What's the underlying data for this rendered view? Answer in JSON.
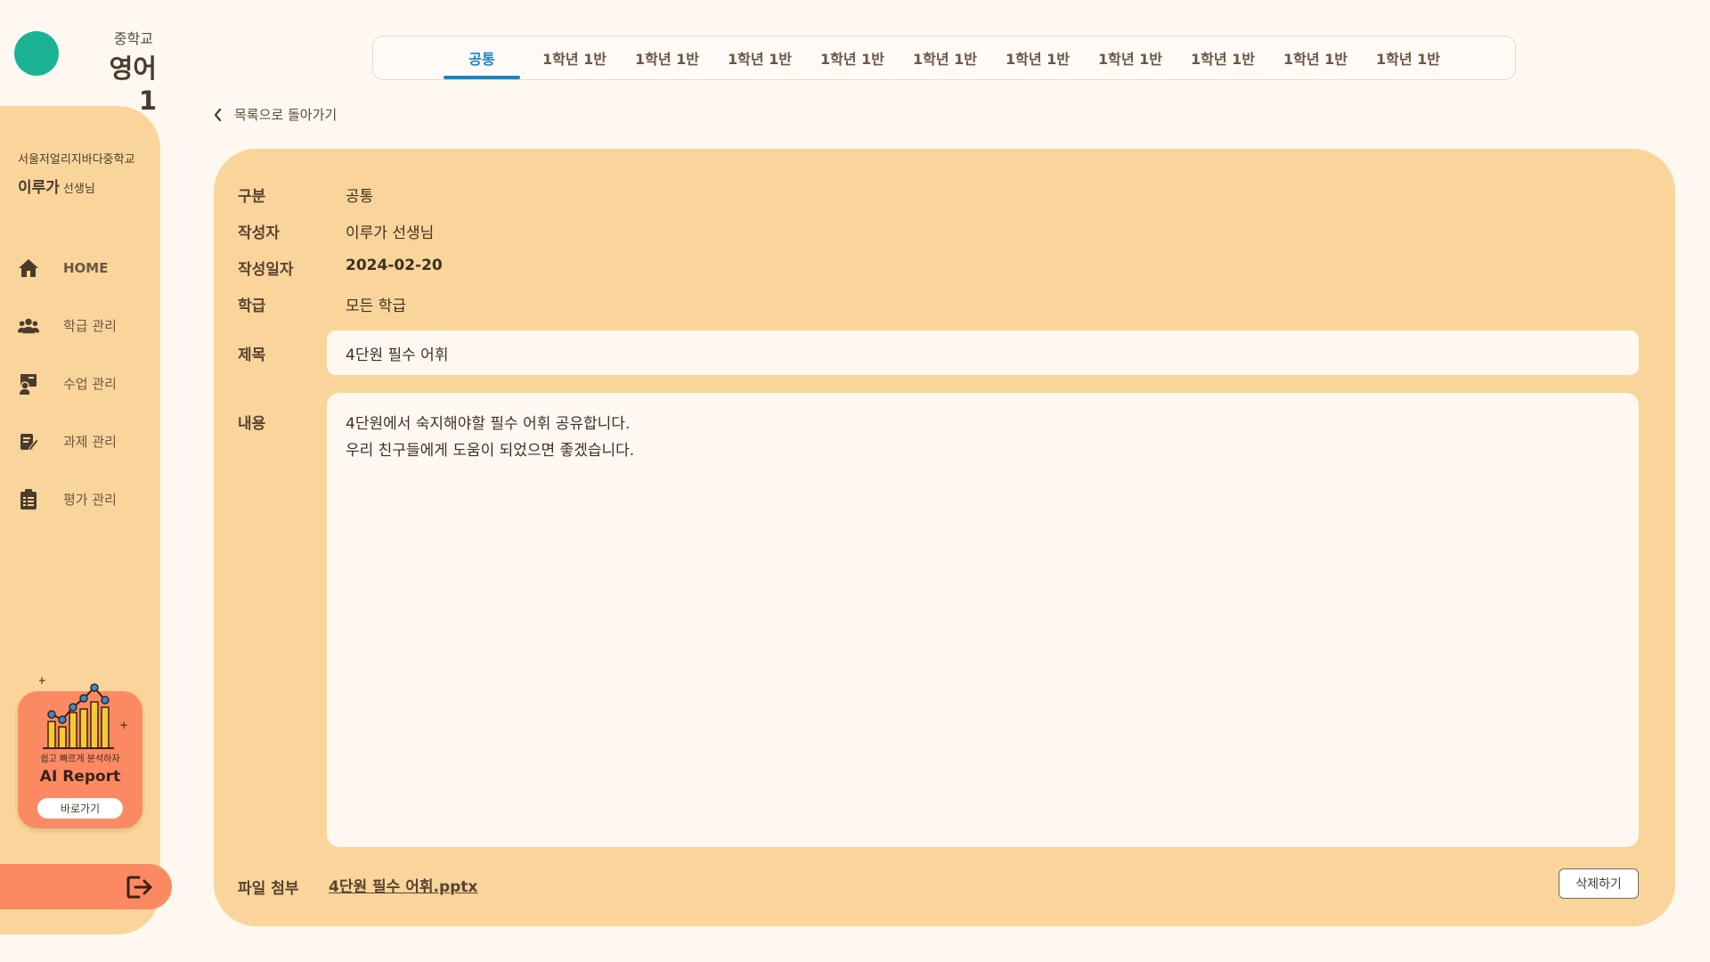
{
  "header": {
    "school_level": "중학교",
    "subject": "영어 1"
  },
  "sidebar": {
    "school_name": "서울저얼리지바다중학교",
    "teacher_name": "이루가",
    "teacher_suffix": "선생님",
    "items": [
      {
        "label": "HOME",
        "icon": "home-icon"
      },
      {
        "label": "학급 관리",
        "icon": "users-icon"
      },
      {
        "label": "수업 관리",
        "icon": "teach-icon"
      },
      {
        "label": "과제 관리",
        "icon": "edit-document-icon"
      },
      {
        "label": "평가 관리",
        "icon": "clipboard-icon"
      }
    ],
    "ai_card": {
      "subtitle": "쉽고 빠르게 분석하자",
      "title": "AI Report",
      "button_label": "바로가기"
    }
  },
  "tabs": [
    {
      "label": "공통",
      "active": true
    },
    {
      "label": "1학년 1반",
      "active": false
    },
    {
      "label": "1학년 1반",
      "active": false
    },
    {
      "label": "1학년 1반",
      "active": false
    },
    {
      "label": "1학년 1반",
      "active": false
    },
    {
      "label": "1학년 1반",
      "active": false
    },
    {
      "label": "1학년 1반",
      "active": false
    },
    {
      "label": "1학년 1반",
      "active": false
    },
    {
      "label": "1학년 1반",
      "active": false
    },
    {
      "label": "1학년 1반",
      "active": false
    },
    {
      "label": "1학년 1반",
      "active": false
    }
  ],
  "back_link": "목록으로 돌아가기",
  "detail": {
    "category_label": "구분",
    "category_value": "공통",
    "author_label": "작성자",
    "author_value": "이루가 선생님",
    "date_label": "작성일자",
    "date_value": "2024-02-20",
    "class_label": "학급",
    "class_value": "모든 학급",
    "title_label": "제목",
    "title_value": "4단원 필수 어휘",
    "content_label": "내용",
    "content_lines": [
      "4단원에서 숙지해야할 필수 어휘 공유합니다.",
      "우리 친구들에게 도움이 되었으면 좋겠습니다."
    ],
    "attach_label": "파일 첨부",
    "attach_file": "4단원 필수 어휘.pptx",
    "delete_label": "삭제하기"
  },
  "colors": {
    "accent_teal": "#1bb394",
    "sidebar_bg": "#fad59b",
    "card_bg": "#fad59b",
    "orange": "#fb8a62",
    "active_tab": "#1b86c4",
    "page_bg": "#fef8f1"
  }
}
